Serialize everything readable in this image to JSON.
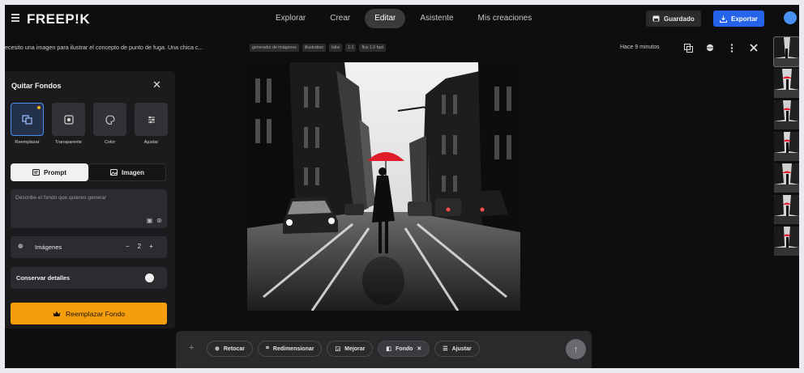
{
  "topbar": {
    "logo": "FREEP!K",
    "tabs": [
      {
        "label": "Explorar",
        "active": false
      },
      {
        "label": "Crear",
        "active": false
      },
      {
        "label": "Editar",
        "active": true
      },
      {
        "label": "Asistente",
        "active": false
      },
      {
        "label": "Mis creaciones",
        "active": false
      }
    ],
    "saved_label": "Guardado",
    "export_label": "Exportar",
    "accent": "#2563eb",
    "menu_icon": "menu-icon",
    "avatar_color": "#4a90f0"
  },
  "info": {
    "prompt": "ecesito una imagen para ilustrar el concepto de punto de fuga. Una chica c...",
    "tags": [
      "generador de imágenes",
      "illustration",
      "b&w",
      "1:1",
      "flux 1.0 fast"
    ],
    "time": "Hace 9 minutos"
  },
  "panel": {
    "title": "Quitar Fondos",
    "options": [
      {
        "label": "Reemplazar",
        "selected": true,
        "icon": "replace-icon"
      },
      {
        "label": "Transparente",
        "selected": false,
        "icon": "transparent-icon"
      },
      {
        "label": "Color",
        "selected": false,
        "icon": "color-icon"
      },
      {
        "label": "Ajustar",
        "selected": false,
        "icon": "adjust-icon"
      }
    ],
    "seg_prompt": "Prompt",
    "seg_image": "Imagen",
    "prompt_placeholder": "Describe el fondo que quieres generar",
    "images_label": "Imágenes",
    "images_count": "2",
    "minus": "−",
    "plus": "+",
    "keep_details_label": "Conservar detalles",
    "keep_details_on": true,
    "cta_label": "Reemplazar Fondo",
    "cta_color": "#f59e0b"
  },
  "toolbar": {
    "plus": "+",
    "tools": [
      {
        "label": "Retocar",
        "icon": "retouch-icon",
        "active": false
      },
      {
        "label": "Redimensionar",
        "icon": "crop-icon",
        "active": false
      },
      {
        "label": "Mejorar",
        "icon": "enhance-icon",
        "active": false
      },
      {
        "label": "Fondo",
        "icon": "background-icon",
        "active": true,
        "closable": true
      },
      {
        "label": "Ajustar",
        "icon": "sliders-icon",
        "active": false
      }
    ],
    "send_icon": "arrow-up-icon"
  },
  "thumbnails_count": 7,
  "image_colors": {
    "umbrella": "#e11d2a"
  }
}
